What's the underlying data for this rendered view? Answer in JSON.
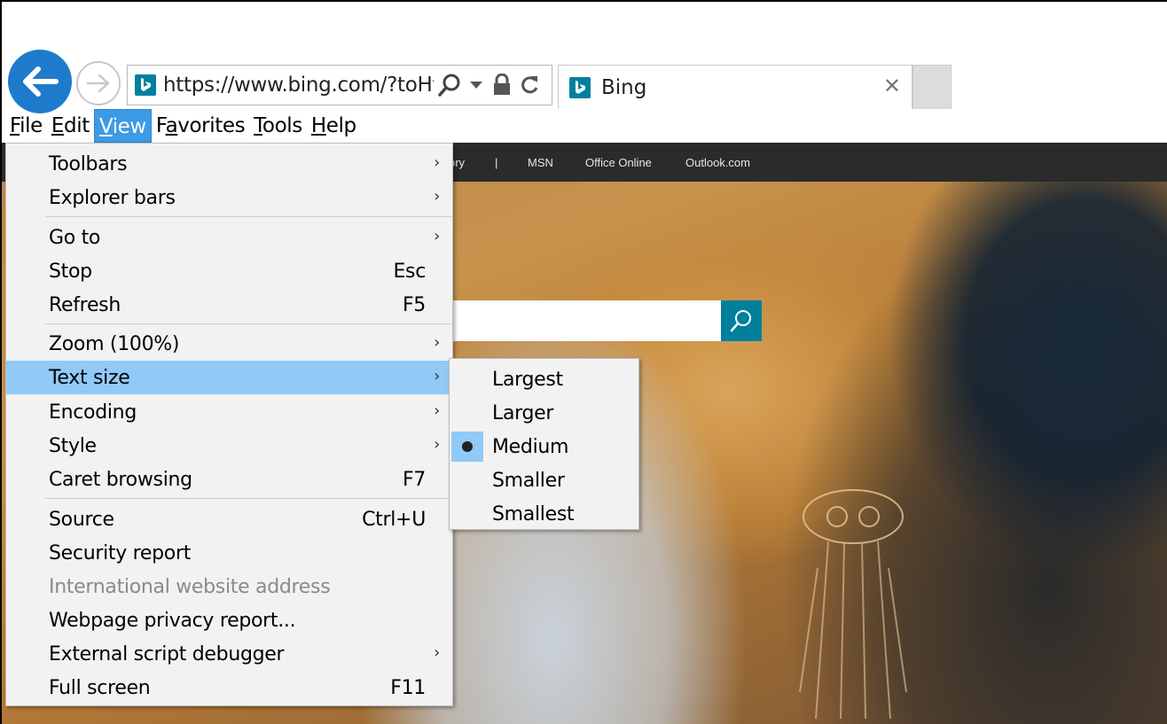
{
  "address_bar": {
    "url": "https://www.bing.com/?toHtl"
  },
  "tab": {
    "title": "Bing",
    "close_glyph": "✕"
  },
  "menubar": {
    "items": [
      {
        "label_pre": "",
        "label_u": "F",
        "label_post": "ile"
      },
      {
        "label_pre": "",
        "label_u": "E",
        "label_post": "dit"
      },
      {
        "label_pre": "",
        "label_u": "V",
        "label_post": "iew"
      },
      {
        "label_pre": "F",
        "label_u": "a",
        "label_post": "vorites"
      },
      {
        "label_pre": "",
        "label_u": "T",
        "label_post": "ools"
      },
      {
        "label_pre": "",
        "label_u": "H",
        "label_post": "elp"
      }
    ]
  },
  "page_nav": {
    "items": [
      "ory",
      "|",
      "MSN",
      "Office Online",
      "Outlook.com"
    ]
  },
  "view_menu": {
    "items": [
      {
        "label": "Toolbars",
        "shortcut": "",
        "arrow": "›"
      },
      {
        "label": "Explorer bars",
        "shortcut": "",
        "arrow": "›"
      },
      {
        "label": "Go to",
        "shortcut": "",
        "arrow": "›"
      },
      {
        "label": "Stop",
        "shortcut": "Esc",
        "arrow": ""
      },
      {
        "label": "Refresh",
        "shortcut": "F5",
        "arrow": ""
      },
      {
        "label": "Zoom (100%)",
        "shortcut": "",
        "arrow": "›"
      },
      {
        "label": "Text size",
        "shortcut": "",
        "arrow": "›"
      },
      {
        "label": "Encoding",
        "shortcut": "",
        "arrow": "›"
      },
      {
        "label": "Style",
        "shortcut": "",
        "arrow": "›"
      },
      {
        "label": "Caret browsing",
        "shortcut": "F7",
        "arrow": ""
      },
      {
        "label": "Source",
        "shortcut": "Ctrl+U",
        "arrow": ""
      },
      {
        "label": "Security report",
        "shortcut": "",
        "arrow": ""
      },
      {
        "label": "International website address",
        "shortcut": "",
        "arrow": ""
      },
      {
        "label": "Webpage privacy report...",
        "shortcut": "",
        "arrow": ""
      },
      {
        "label": "External script debugger",
        "shortcut": "",
        "arrow": "›"
      },
      {
        "label": "Full screen",
        "shortcut": "F11",
        "arrow": ""
      }
    ]
  },
  "text_size_menu": {
    "items": [
      {
        "label": "Largest"
      },
      {
        "label": "Larger"
      },
      {
        "label": "Medium"
      },
      {
        "label": "Smaller"
      },
      {
        "label": "Smallest"
      }
    ],
    "selected": "Medium"
  },
  "colors": {
    "accent_blue": "#1e7bcc",
    "menu_highlight": "#91c9f7",
    "bing_teal": "#00809d"
  }
}
